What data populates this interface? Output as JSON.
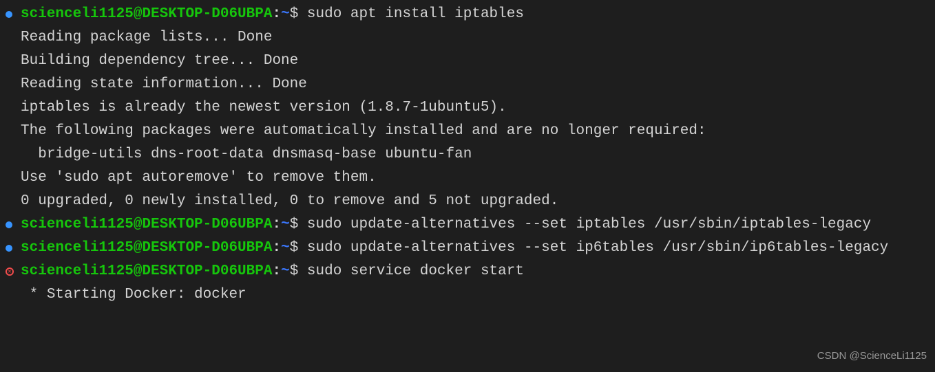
{
  "prompt": {
    "user_host": "scienceli1125@DESKTOP-D06UBPA",
    "separator": ":",
    "cwd": "~",
    "sigil": "$"
  },
  "entries": [
    {
      "status": "ok",
      "command": "sudo apt install iptables",
      "output": [
        "Reading package lists... Done",
        "Building dependency tree... Done",
        "Reading state information... Done",
        "iptables is already the newest version (1.8.7-1ubuntu5).",
        "The following packages were automatically installed and are no longer required:",
        "  bridge-utils dns-root-data dnsmasq-base ubuntu-fan",
        "Use 'sudo apt autoremove' to remove them.",
        "0 upgraded, 0 newly installed, 0 to remove and 5 not upgraded."
      ]
    },
    {
      "status": "ok",
      "command": "sudo update-alternatives --set iptables /usr/sbin/iptables-legacy",
      "output": []
    },
    {
      "status": "ok",
      "command": "sudo update-alternatives --set ip6tables /usr/sbin/ip6tables-legacy",
      "output": []
    },
    {
      "status": "err",
      "command": "sudo service docker start",
      "output": [
        " * Starting Docker: docker"
      ]
    }
  ],
  "watermark": "CSDN @ScienceLi1125"
}
